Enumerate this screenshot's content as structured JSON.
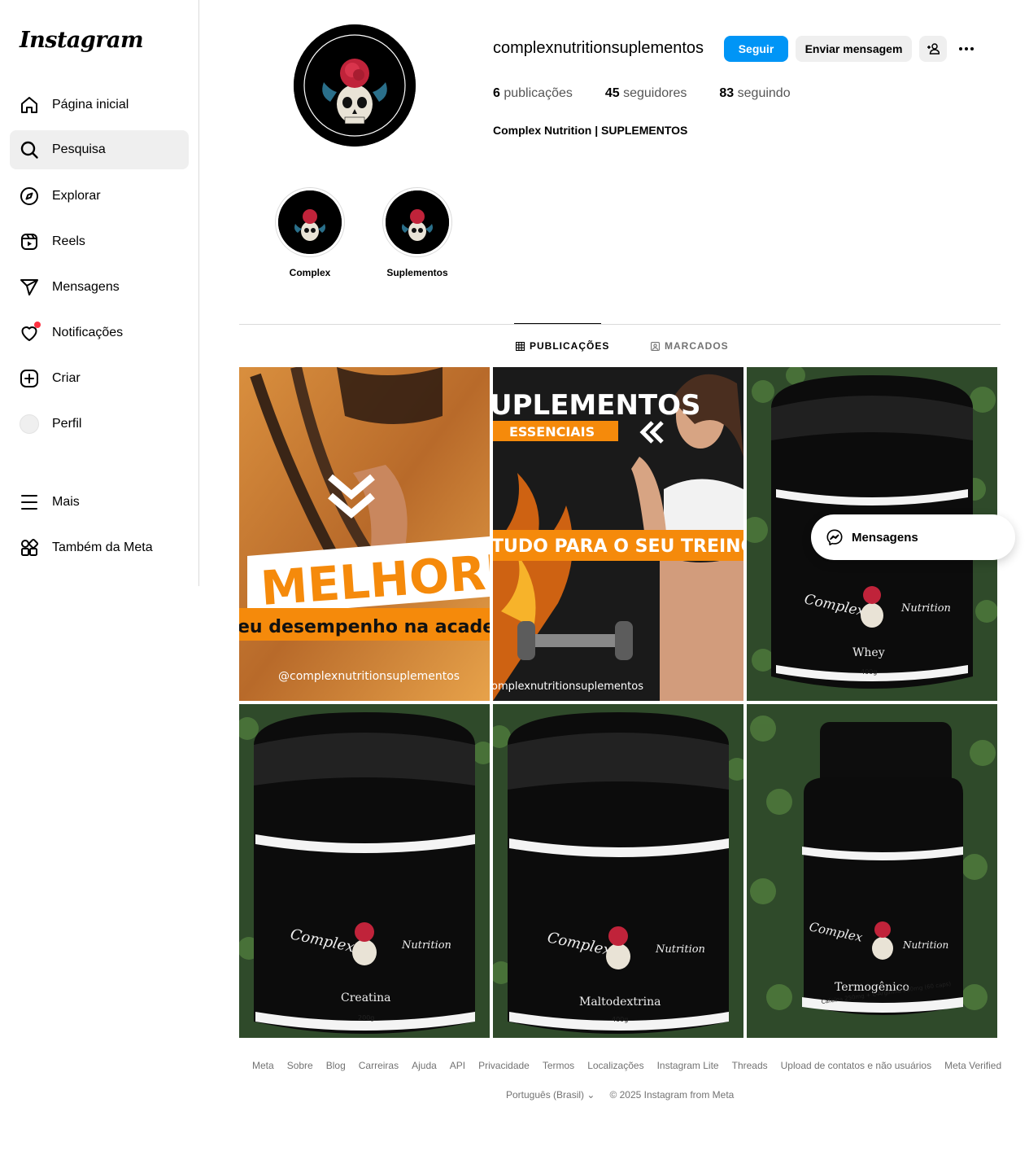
{
  "app": {
    "logo_text": "Instagram"
  },
  "sidebar": {
    "items": [
      {
        "label": "Página inicial",
        "icon": "home-icon"
      },
      {
        "label": "Pesquisa",
        "icon": "search-icon",
        "active": true
      },
      {
        "label": "Explorar",
        "icon": "compass-icon"
      },
      {
        "label": "Reels",
        "icon": "reels-icon"
      },
      {
        "label": "Mensagens",
        "icon": "send-icon"
      },
      {
        "label": "Notificações",
        "icon": "heart-icon",
        "badge": true
      },
      {
        "label": "Criar",
        "icon": "plus-square-icon"
      },
      {
        "label": "Perfil",
        "icon": "avatar-icon"
      },
      {
        "label": "Mais",
        "icon": "menu-icon"
      },
      {
        "label": "Também da Meta",
        "icon": "meta-apps-icon"
      }
    ]
  },
  "profile": {
    "username": "complexnutritionsuplementos",
    "follow_label": "Seguir",
    "message_label": "Enviar mensagem",
    "stats": {
      "posts_count": "6",
      "posts_word": "publicações",
      "followers_count": "45",
      "followers_word": "seguidores",
      "following_count": "83",
      "following_word": "seguindo"
    },
    "bio_name": "Complex Nutrition | SUPLEMENTOS"
  },
  "highlights": [
    {
      "label": "Complex"
    },
    {
      "label": "Suplementos"
    }
  ],
  "tabs": [
    {
      "label": "PUBLICAÇÕES",
      "active": true
    },
    {
      "label": "MARCADOS",
      "active": false
    }
  ],
  "posts": [
    {
      "headline": "MELHORE",
      "subline": "eu desempenho na academ",
      "handle": "@complexnutritionsuplementos"
    },
    {
      "headline": "UPLEMENTOS",
      "tag": "ESSENCIAIS",
      "subline": "TUDO PARA O SEU TREINO!",
      "handle": "omplexnutritionsuplementos"
    },
    {
      "brand": "Complex",
      "brand2": "Nutrition",
      "product": "Whey",
      "weight": "400g"
    },
    {
      "brand": "Complex",
      "brand2": "Nutrition",
      "product": "Creatina",
      "weight": "200g"
    },
    {
      "brand": "Complex",
      "brand2": "Nutrition",
      "product": "Maltodextrina",
      "weight": "400g"
    },
    {
      "brand": "Complex",
      "brand2": "Nutrition",
      "product": "Termogênico",
      "weight": "Cafeína 250mg + L-Arginina 250mg (60 caps)"
    }
  ],
  "floating_messages": {
    "label": "Mensagens"
  },
  "footer": {
    "links": [
      "Meta",
      "Sobre",
      "Blog",
      "Carreiras",
      "Ajuda",
      "API",
      "Privacidade",
      "Termos",
      "Localizações",
      "Instagram Lite",
      "Threads",
      "Upload de contatos e não usuários",
      "Meta Verified"
    ],
    "language": "Português (Brasil)",
    "copyright": "© 2025 Instagram from Meta"
  },
  "colors": {
    "primary_button": "#0095f6",
    "notification_dot": "#ff3040",
    "accent_orange": "#f58a0b"
  }
}
